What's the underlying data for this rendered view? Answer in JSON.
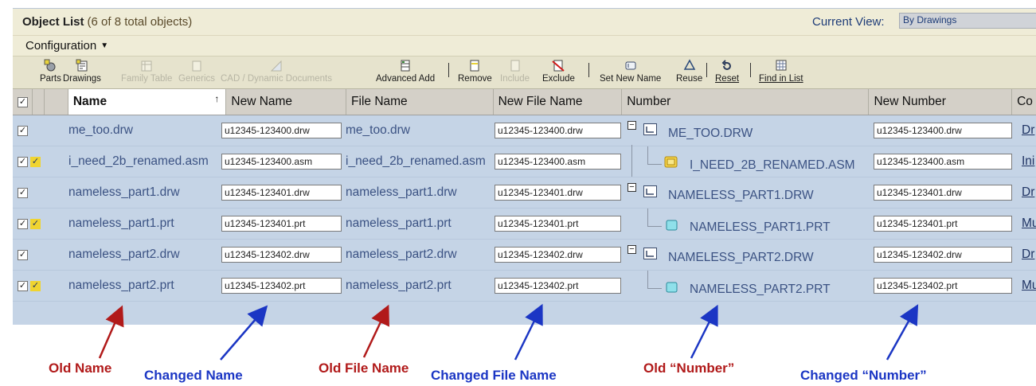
{
  "header": {
    "title": "Object List",
    "count": "(6 of 8 total objects)",
    "current_view_label": "Current View:",
    "current_view_value": "By Drawings"
  },
  "configuration": {
    "label": "Configuration"
  },
  "toolbar": {
    "parts": "Parts",
    "drawings": "Drawings",
    "family_table": "Family Table",
    "generics": "Generics",
    "cad_docs": "CAD / Dynamic Documents",
    "advanced_add": "Advanced Add",
    "remove": "Remove",
    "include": "Include",
    "exclude": "Exclude",
    "set_new_name": "Set New Name",
    "reuse": "Reuse",
    "reset": "Reset",
    "find_in_list": "Find in List"
  },
  "columns": {
    "name": "Name",
    "new_name": "New Name",
    "file_name": "File Name",
    "new_file_name": "New File Name",
    "number": "Number",
    "new_number": "New Number",
    "col_c": "Co"
  },
  "rows": [
    {
      "name": "me_too.drw",
      "new_name": "u12345-123400.drw",
      "file_name": "me_too.drw",
      "new_file_name": "u12345-123400.drw",
      "number": "ME_TOO.DRW",
      "new_number": "u12345-123400.drw",
      "link": "Dr"
    },
    {
      "name": "i_need_2b_renamed.asm",
      "new_name": "u12345-123400.asm",
      "file_name": "i_need_2b_renamed.asm",
      "new_file_name": "u12345-123400.asm",
      "number": "I_NEED_2B_RENAMED.ASM",
      "new_number": "u12345-123400.asm",
      "link": "Ini"
    },
    {
      "name": "nameless_part1.drw",
      "new_name": "u12345-123401.drw",
      "file_name": "nameless_part1.drw",
      "new_file_name": "u12345-123401.drw",
      "number": "NAMELESS_PART1.DRW",
      "new_number": "u12345-123401.drw",
      "link": "Dr"
    },
    {
      "name": "nameless_part1.prt",
      "new_name": "u12345-123401.prt",
      "file_name": "nameless_part1.prt",
      "new_file_name": "u12345-123401.prt",
      "number": "NAMELESS_PART1.PRT",
      "new_number": "u12345-123401.prt",
      "link": "Mu"
    },
    {
      "name": "nameless_part2.drw",
      "new_name": "u12345-123402.drw",
      "file_name": "nameless_part2.drw",
      "new_file_name": "u12345-123402.drw",
      "number": "NAMELESS_PART2.DRW",
      "new_number": "u12345-123402.drw",
      "link": "Dr"
    },
    {
      "name": "nameless_part2.prt",
      "new_name": "u12345-123402.prt",
      "file_name": "nameless_part2.prt",
      "new_file_name": "u12345-123402.prt",
      "number": "NAMELESS_PART2.PRT",
      "new_number": "u12345-123402.prt",
      "link": "Mu"
    }
  ],
  "annotations": {
    "old_name": "Old Name",
    "changed_name": "Changed Name",
    "old_file_name": "Old File Name",
    "changed_file_name": "Changed File Name",
    "old_number": "Old “Number”",
    "changed_number": "Changed “Number”"
  },
  "colors": {
    "table_bg": "#c5d4e6",
    "header_bg": "#efecd7",
    "annot_red": "#b11a1a",
    "annot_blue": "#1b36c4"
  }
}
